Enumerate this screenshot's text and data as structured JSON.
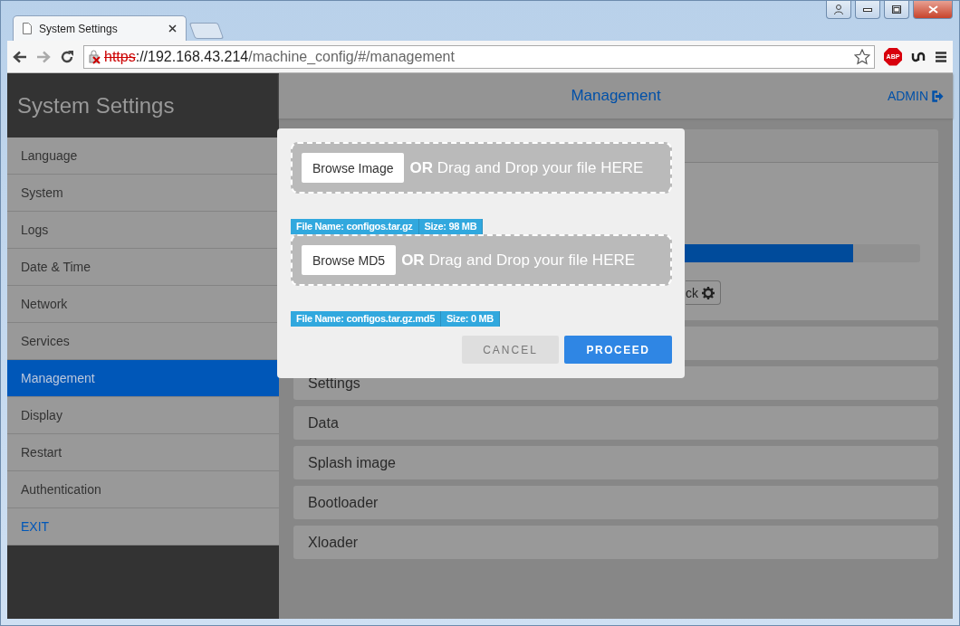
{
  "browser": {
    "tab_title": "System Settings",
    "url": {
      "scheme": "https",
      "host": "://192.168.43.214",
      "path": "/machine_config/#/management"
    },
    "extension_label": "ABP"
  },
  "header": {
    "title": "Management",
    "user": "ADMIN"
  },
  "sidebar": {
    "title": "System Settings",
    "items": [
      {
        "label": "Language",
        "kind": "page",
        "selected": false
      },
      {
        "label": "System",
        "kind": "page",
        "selected": false
      },
      {
        "label": "Logs",
        "kind": "page",
        "selected": false
      },
      {
        "label": "Date & Time",
        "kind": "page",
        "selected": false
      },
      {
        "label": "Network",
        "kind": "page",
        "selected": false
      },
      {
        "label": "Services",
        "kind": "page",
        "selected": false
      },
      {
        "label": "Management",
        "kind": "page",
        "selected": true
      },
      {
        "label": "Display",
        "kind": "page",
        "selected": false
      },
      {
        "label": "Restart",
        "kind": "page",
        "selected": false
      },
      {
        "label": "Authentication",
        "kind": "page",
        "selected": false
      },
      {
        "label": "EXIT",
        "kind": "exit",
        "selected": false
      }
    ]
  },
  "upload_panel": {
    "progress": {
      "level": 0.89
    },
    "button_label": "ck"
  },
  "sections": [
    {
      "label": "Settings"
    },
    {
      "label": "Data"
    },
    {
      "label": "Splash image"
    },
    {
      "label": "Bootloader"
    },
    {
      "label": "Xloader"
    }
  ],
  "dialog": {
    "drop_zones": [
      {
        "button": "Browse Image",
        "or": "OR",
        "hint": "Drag and Drop your file HERE",
        "file_name": "File Name: configos.tar.gz",
        "file_size": "Size: 98 MB"
      },
      {
        "button": "Browse MD5",
        "or": "OR",
        "hint": "Drag and Drop your file HERE",
        "file_name": "File Name: configos.tar.gz.md5",
        "file_size": "Size: 0 MB"
      }
    ],
    "buttons": [
      {
        "label": "CANCEL",
        "kind": "secondary"
      },
      {
        "label": "PROCEED",
        "kind": "primary"
      }
    ]
  }
}
